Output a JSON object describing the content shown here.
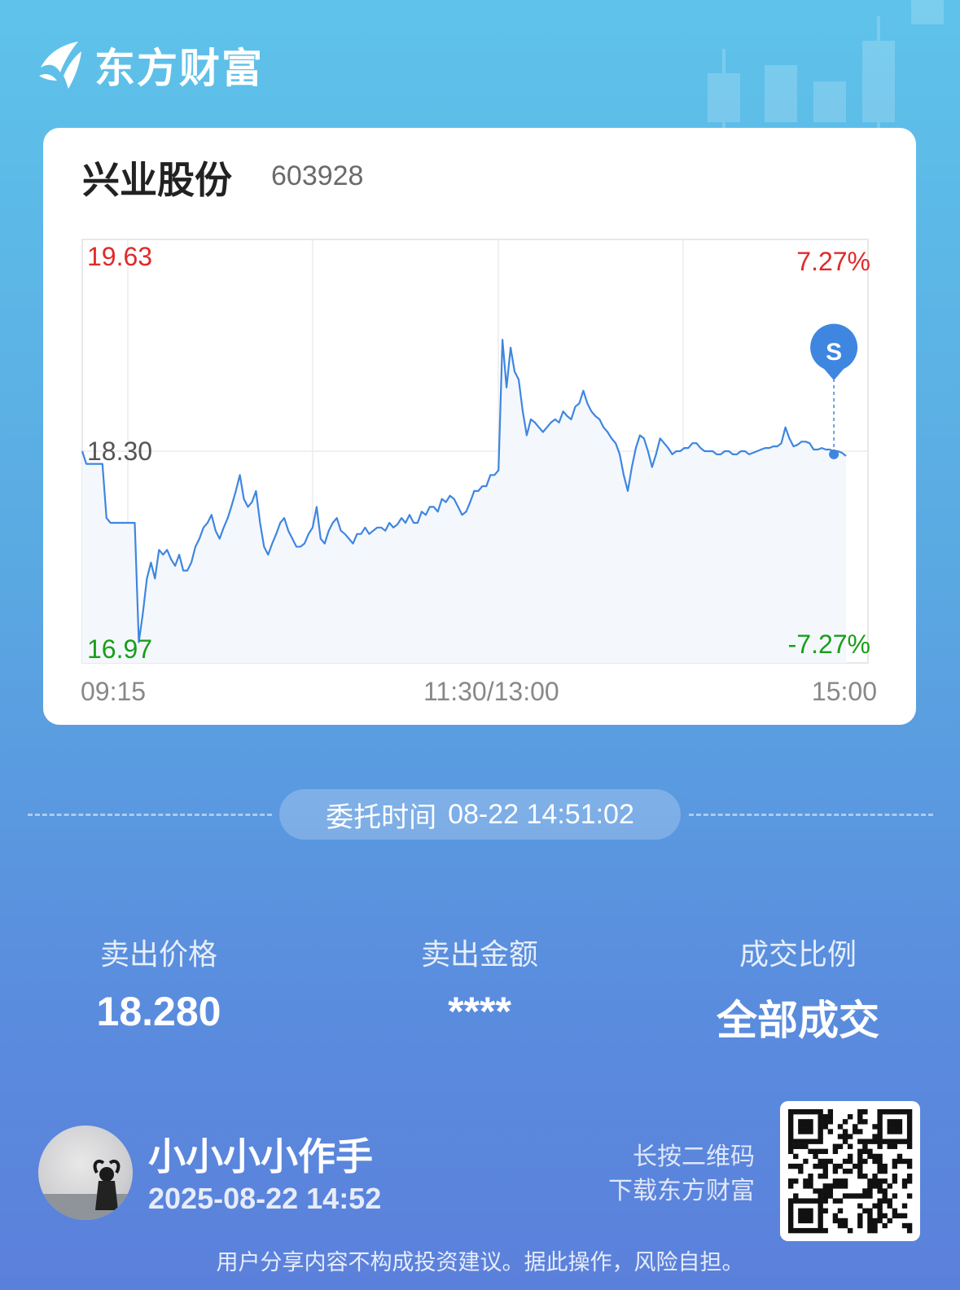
{
  "brand": {
    "name": "东方财富",
    "icon": "eastmoney-logo-icon"
  },
  "stock": {
    "name": "兴业股份",
    "code": "603928"
  },
  "chart_data": {
    "type": "line",
    "title": "",
    "x_labels": [
      "09:15",
      "11:30/13:00",
      "15:00"
    ],
    "y_max": "19.63",
    "y_mid": "18.30",
    "y_min": "16.97",
    "pct_max": "7.27%",
    "pct_min": "-7.27%",
    "ylim": [
      16.97,
      19.63
    ],
    "series": [
      {
        "values": [
          18.3,
          18.22,
          18.22,
          18.22,
          18.22,
          18.22,
          17.88,
          17.85,
          17.85,
          17.85,
          17.85,
          17.85,
          17.85,
          17.85,
          17.1,
          17.28,
          17.5,
          17.6,
          17.5,
          17.68,
          17.65,
          17.68,
          17.62,
          17.58,
          17.65,
          17.55,
          17.55,
          17.6,
          17.7,
          17.75,
          17.82,
          17.85,
          17.9,
          17.8,
          17.75,
          17.82,
          17.88,
          17.96,
          18.05,
          18.15,
          18.0,
          17.95,
          17.98,
          18.05,
          17.85,
          17.7,
          17.65,
          17.72,
          17.78,
          17.85,
          17.88,
          17.8,
          17.75,
          17.7,
          17.7,
          17.72,
          17.78,
          17.82,
          17.95,
          17.75,
          17.72,
          17.8,
          17.85,
          17.88,
          17.8,
          17.78,
          17.75,
          17.72,
          17.78,
          17.78,
          17.82,
          17.78,
          17.8,
          17.82,
          17.82,
          17.8,
          17.85,
          17.82,
          17.84,
          17.88,
          17.85,
          17.9,
          17.85,
          17.85,
          17.92,
          17.9,
          17.95,
          17.95,
          17.92,
          18.0,
          17.98,
          18.02,
          18.0,
          17.95,
          17.9,
          17.92,
          17.98,
          18.05,
          18.05,
          18.08,
          18.08,
          18.15,
          18.15,
          18.18,
          19.0,
          18.7,
          18.95,
          18.8,
          18.75,
          18.55,
          18.4,
          18.5,
          18.48,
          18.45,
          18.42,
          18.45,
          18.48,
          18.5,
          18.48,
          18.55,
          18.52,
          18.5,
          18.58,
          18.6,
          18.68,
          18.6,
          18.55,
          18.52,
          18.5,
          18.45,
          18.42,
          18.38,
          18.35,
          18.28,
          18.15,
          18.05,
          18.2,
          18.32,
          18.4,
          18.38,
          18.3,
          18.2,
          18.28,
          18.38,
          18.35,
          18.32,
          18.28,
          18.3,
          18.3,
          18.32,
          18.32,
          18.35,
          18.35,
          18.32,
          18.3,
          18.3,
          18.3,
          18.28,
          18.28,
          18.3,
          18.3,
          18.28,
          18.28,
          18.3,
          18.3,
          18.28,
          18.29,
          18.3,
          18.31,
          18.32,
          18.32,
          18.33,
          18.33,
          18.35,
          18.45,
          18.38,
          18.33,
          18.34,
          18.36,
          18.36,
          18.35,
          18.31,
          18.31,
          18.32,
          18.31,
          18.31,
          18.3,
          18.3,
          18.29,
          18.27
        ]
      }
    ],
    "grid": true,
    "marker": {
      "label": "S",
      "price": 18.28,
      "time": "14:51",
      "color": "#3f86e0"
    }
  },
  "order": {
    "time_label": "委托时间",
    "time_value": "08-22 14:51:02"
  },
  "stats": [
    {
      "label": "卖出价格",
      "value": "18.280"
    },
    {
      "label": "卖出金额",
      "value": "****"
    },
    {
      "label": "成交比例",
      "value": "全部成交"
    }
  ],
  "user": {
    "name": "小小小小作手",
    "time": "2025-08-22 14:52",
    "avatar_icon": "user-avatar-icon"
  },
  "qr": {
    "hint_line1": "长按二维码",
    "hint_line2": "下载东方财富",
    "icon": "qr-code-icon"
  },
  "disclaimer": "用户分享内容不构成投资建议。据此操作，风险自担。",
  "colors": {
    "up": "#e02a2a",
    "down": "#1a9e1a",
    "line": "#3f86e0",
    "fill": "#f4f8fd"
  }
}
